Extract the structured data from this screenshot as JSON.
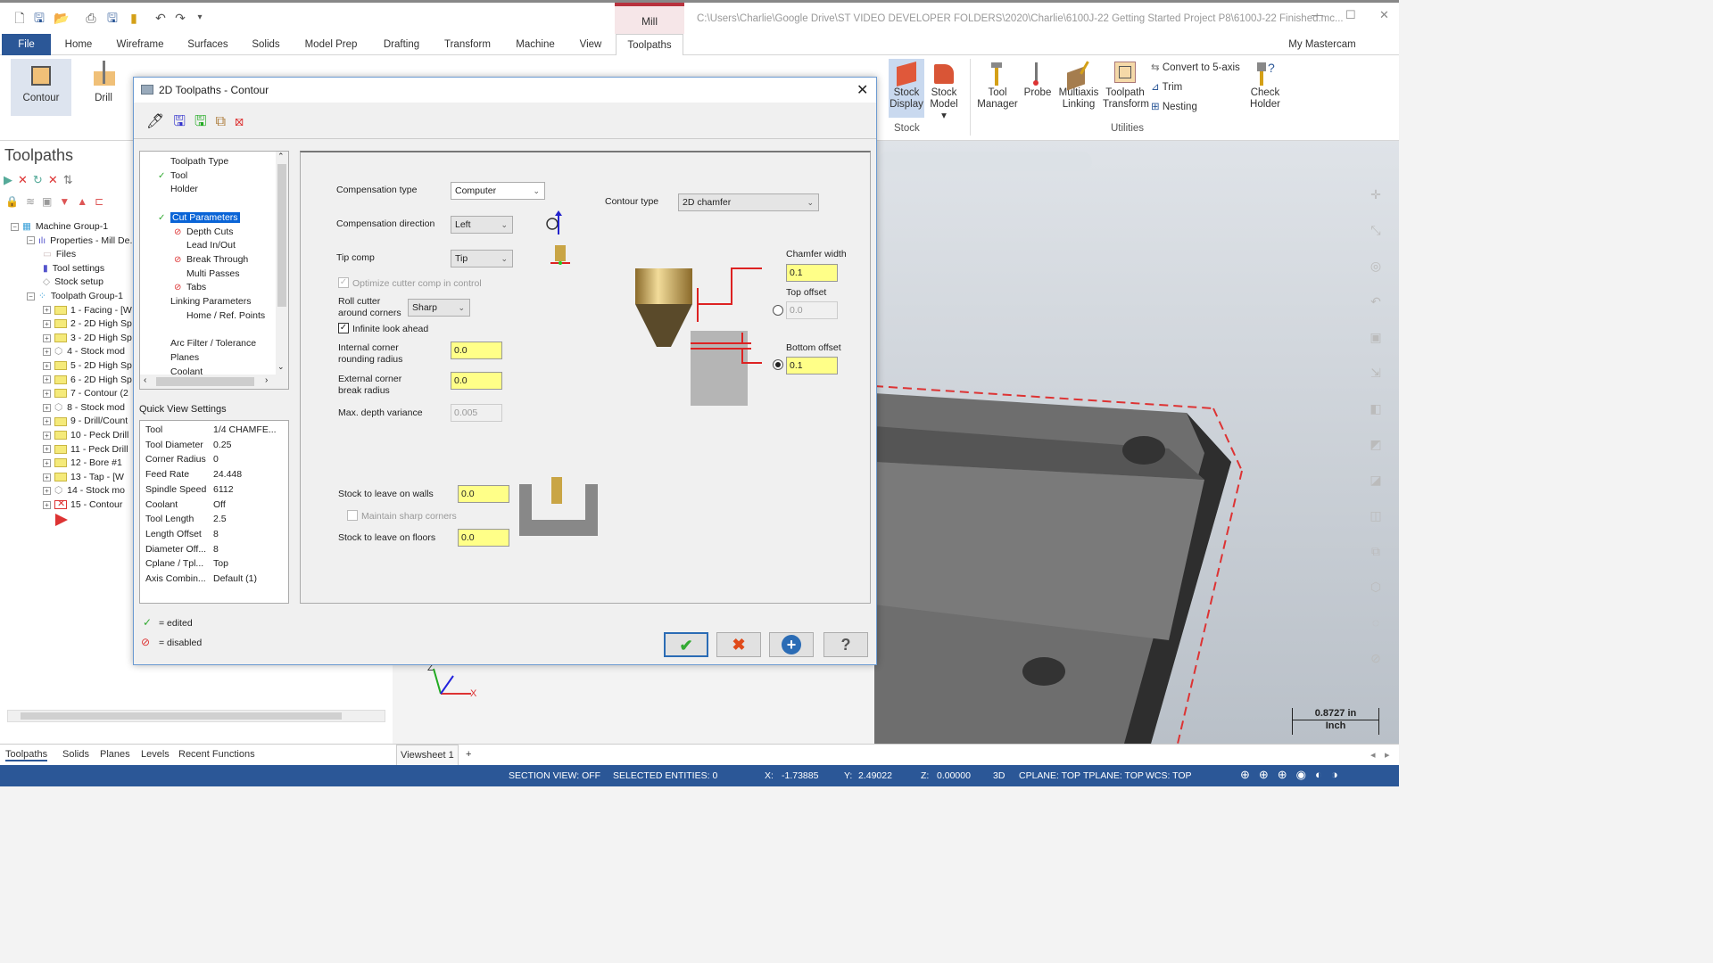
{
  "titlebar": {
    "context_tab": "Mill",
    "file_path": "C:\\Users\\Charlie\\Google Drive\\ST VIDEO DEVELOPER FOLDERS\\2020\\Charlie\\6100J-22 Getting Started Project P8\\6100J-22 Finished.mc...",
    "quick_access": [
      "new-icon",
      "save-icon",
      "open-icon",
      "print-icon",
      "save-as-icon",
      "folder-icon",
      "undo-icon",
      "redo-icon",
      "customize-icon"
    ]
  },
  "ribbon_tabs": [
    "File",
    "Home",
    "Wireframe",
    "Surfaces",
    "Solids",
    "Model Prep",
    "Drafting",
    "Transform",
    "Machine",
    "View",
    "Toolpaths"
  ],
  "active_tab": "Toolpaths",
  "my_mastercam": "My Mastercam",
  "ribbon": {
    "left_buttons": [
      {
        "label": "Contour"
      },
      {
        "label": "Drill"
      }
    ],
    "stock_group": {
      "label": "Stock",
      "buttons": [
        {
          "label": "Stock Display"
        },
        {
          "label": "Stock Model ▾"
        }
      ]
    },
    "utilities_group": {
      "label": "Utilities",
      "buttons": [
        {
          "label": "Tool Manager"
        },
        {
          "label": "Probe"
        },
        {
          "label": "Multiaxis Linking"
        },
        {
          "label": "Toolpath Transform"
        },
        {
          "label": "Check Holder"
        }
      ],
      "small_buttons": [
        {
          "label": "Convert to 5-axis"
        },
        {
          "label": "Trim"
        },
        {
          "label": "Nesting"
        }
      ]
    }
  },
  "left_panel": {
    "title": "Toolpaths",
    "tree": [
      {
        "label": "Machine Group-1",
        "level": 0,
        "kind": "machine"
      },
      {
        "label": "Properties - Mill De...",
        "level": 1,
        "kind": "props"
      },
      {
        "label": "Files",
        "level": 2,
        "kind": "files"
      },
      {
        "label": "Tool settings",
        "level": 2,
        "kind": "tool"
      },
      {
        "label": "Stock setup",
        "level": 2,
        "kind": "stock"
      },
      {
        "label": "Toolpath Group-1",
        "level": 1,
        "kind": "group"
      },
      {
        "label": "1 - Facing - [W",
        "level": 2,
        "kind": "folder"
      },
      {
        "label": "2 - 2D High Sp",
        "level": 2,
        "kind": "folder"
      },
      {
        "label": "3 - 2D High Sp",
        "level": 2,
        "kind": "folder"
      },
      {
        "label": "4 - Stock mod",
        "level": 2,
        "kind": "stockmodel"
      },
      {
        "label": "5 - 2D High Sp",
        "level": 2,
        "kind": "folder"
      },
      {
        "label": "6 - 2D High Sp",
        "level": 2,
        "kind": "folder"
      },
      {
        "label": "7 - Contour (2",
        "level": 2,
        "kind": "folder"
      },
      {
        "label": "8 - Stock mod",
        "level": 2,
        "kind": "stockmodel"
      },
      {
        "label": "9 - Drill/Count",
        "level": 2,
        "kind": "folder"
      },
      {
        "label": "10 - Peck Drill",
        "level": 2,
        "kind": "folder"
      },
      {
        "label": "11 - Peck Drill",
        "level": 2,
        "kind": "folder"
      },
      {
        "label": "12 - Bore #1",
        "level": 2,
        "kind": "folder"
      },
      {
        "label": "13 - Tap - [W",
        "level": 2,
        "kind": "folder"
      },
      {
        "label": "14 - Stock mo",
        "level": 2,
        "kind": "stockmodel"
      },
      {
        "label": "15 - Contour",
        "level": 2,
        "kind": "folder-error"
      }
    ]
  },
  "bottom_tabs": [
    "Toolpaths",
    "Solids",
    "Planes",
    "Levels",
    "Recent Functions"
  ],
  "viewsheet": {
    "tab": "Viewsheet 1",
    "add": "+"
  },
  "statusbar": {
    "section_view": "SECTION VIEW: OFF",
    "selected": "SELECTED ENTITIES: 0",
    "x_label": "X:",
    "x": "-1.73885",
    "y_label": "Y:",
    "y": "2.49022",
    "z_label": "Z:",
    "z": "0.00000",
    "mode": "3D",
    "cplane": "CPLANE: TOP",
    "tplane": "TPLANE: TOP",
    "wcs": "WCS: TOP"
  },
  "viewport": {
    "scale_value": "0.8727 in",
    "scale_unit": "Inch",
    "axis_x": "X",
    "axis_z": "Z"
  },
  "dialog": {
    "title": "2D Toolpaths - Contour",
    "nav_tree": [
      {
        "label": "Toolpath Type",
        "status": "none",
        "level": 0
      },
      {
        "label": "Tool",
        "status": "edited",
        "level": 0
      },
      {
        "label": "Holder",
        "status": "none",
        "level": 0
      },
      {
        "label": "",
        "status": "none",
        "level": 0
      },
      {
        "label": "Cut Parameters",
        "status": "edited",
        "level": 0,
        "selected": true
      },
      {
        "label": "Depth Cuts",
        "status": "disabled",
        "level": 1
      },
      {
        "label": "Lead In/Out",
        "status": "none",
        "level": 1
      },
      {
        "label": "Break Through",
        "status": "disabled",
        "level": 1
      },
      {
        "label": "Multi Passes",
        "status": "none",
        "level": 1
      },
      {
        "label": "Tabs",
        "status": "disabled",
        "level": 1
      },
      {
        "label": "Linking Parameters",
        "status": "none",
        "level": 0
      },
      {
        "label": "Home / Ref. Points",
        "status": "none",
        "level": 1
      },
      {
        "label": "",
        "status": "none",
        "level": 0
      },
      {
        "label": "Arc Filter / Tolerance",
        "status": "none",
        "level": 0
      },
      {
        "label": "Planes",
        "status": "none",
        "level": 0
      },
      {
        "label": "Coolant",
        "status": "none",
        "level": 0
      }
    ],
    "quick_view": {
      "title": "Quick View Settings",
      "rows": [
        [
          "Tool",
          "1/4 CHAMFE..."
        ],
        [
          "Tool Diameter",
          "0.25"
        ],
        [
          "Corner Radius",
          "0"
        ],
        [
          "Feed Rate",
          "24.448"
        ],
        [
          "Spindle Speed",
          "6112"
        ],
        [
          "Coolant",
          "Off"
        ],
        [
          "Tool Length",
          "2.5"
        ],
        [
          "Length Offset",
          "8"
        ],
        [
          "Diameter Off...",
          "8"
        ],
        [
          "Cplane / Tpl...",
          "Top"
        ],
        [
          "Axis Combin...",
          "Default (1)"
        ]
      ]
    },
    "legend": {
      "edited": "= edited",
      "disabled": "= disabled"
    },
    "params": {
      "comp_type_label": "Compensation type",
      "comp_type": "Computer",
      "comp_dir_label": "Compensation direction",
      "comp_dir": "Left",
      "tip_comp_label": "Tip comp",
      "tip_comp": "Tip",
      "optimize_label": "Optimize cutter comp in control",
      "roll_label_1": "Roll cutter",
      "roll_label_2": "around corners",
      "roll": "Sharp",
      "infinite_label": "Infinite look ahead",
      "int_corner_1": "Internal corner",
      "int_corner_2": "rounding radius",
      "int_corner": "0.0",
      "ext_corner_1": "External corner",
      "ext_corner_2": "break radius",
      "ext_corner": "0.0",
      "max_depth_label": "Max. depth variance",
      "max_depth": "0.005",
      "contour_type_label": "Contour type",
      "contour_type": "2D chamfer",
      "chamfer_width_label": "Chamfer width",
      "chamfer_width": "0.1",
      "top_offset_label": "Top offset",
      "top_offset": "0.0",
      "bottom_offset_label": "Bottom offset",
      "bottom_offset": "0.1",
      "stock_walls_label": "Stock to leave on walls",
      "stock_walls": "0.0",
      "maintain_label": "Maintain sharp corners",
      "stock_floors_label": "Stock to leave on floors",
      "stock_floors": "0.0"
    },
    "buttons": {
      "ok": "✔",
      "cancel": "✖",
      "add": "+",
      "help": "?"
    }
  }
}
